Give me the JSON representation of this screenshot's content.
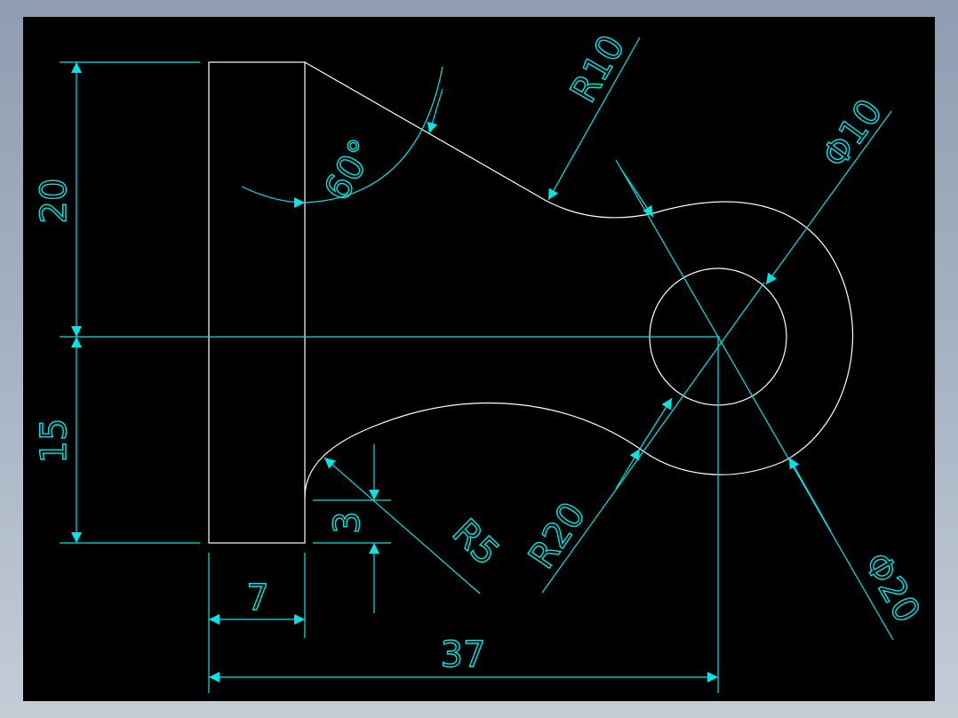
{
  "colors": {
    "background": "#000000",
    "geometry": "#ffffff",
    "dimension": "#00e5e5"
  },
  "dimensions": {
    "height_upper": "20",
    "height_lower": "15",
    "width_flange": "7",
    "overall_length": "37",
    "chamfer_angle": "60°",
    "fillet_upper": "R10",
    "hole_diameter": "Φ10",
    "boss_diameter": "Φ20",
    "fillet_lower_large": "R20",
    "fillet_lower_small": "R5",
    "offset": "3"
  }
}
